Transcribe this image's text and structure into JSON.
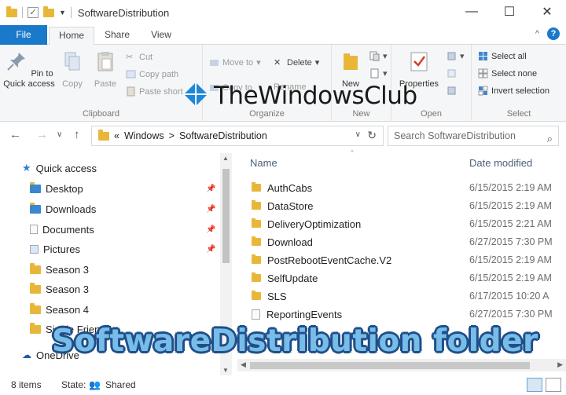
{
  "window": {
    "title": "SoftwareDistribution",
    "buttons": [
      "—",
      "☐",
      "✕"
    ]
  },
  "tabs": {
    "file": "File",
    "home": "Home",
    "share": "Share",
    "view": "View"
  },
  "ribbon": {
    "clipboard": {
      "pin": "Pin to Quick access",
      "copy": "Copy",
      "paste": "Paste",
      "cut": "Cut",
      "copy_path": "Copy path",
      "paste_shortcut": "Paste short",
      "label": "Clipboard"
    },
    "organize": {
      "move_to": "Move to",
      "delete": "Delete",
      "copy_to": "Copy to",
      "rename": "Rename",
      "label": "Organize"
    },
    "new": {
      "new_folder": "New",
      "label": "New"
    },
    "open": {
      "properties": "Properties",
      "label": "Open"
    },
    "select": {
      "select_all": "Select all",
      "select_none": "Select none",
      "invert": "Invert selection",
      "label": "Select"
    }
  },
  "watermark": "TheWindowsClub",
  "address": {
    "prefix": "«",
    "segments": [
      "Windows",
      "SoftwareDistribution"
    ],
    "separator": ">",
    "search_placeholder": "Search SoftwareDistribution"
  },
  "nav": {
    "quick_access": "Quick access",
    "items": [
      {
        "label": "Desktop",
        "pinned": true
      },
      {
        "label": "Downloads",
        "pinned": true
      },
      {
        "label": "Documents",
        "pinned": true
      },
      {
        "label": "Pictures",
        "pinned": true
      },
      {
        "label": "Season 3",
        "pinned": false
      },
      {
        "label": "Season 3",
        "pinned": false
      },
      {
        "label": "Season 4",
        "pinned": false
      },
      {
        "label": "Single Friends",
        "pinned": false
      }
    ],
    "onedrive": "OneDrive"
  },
  "columns": {
    "name": "Name",
    "date_modified": "Date modified"
  },
  "files": [
    {
      "name": "AuthCabs",
      "date": "6/15/2015 2:19 AM",
      "type": "folder"
    },
    {
      "name": "DataStore",
      "date": "6/15/2015 2:19 AM",
      "type": "folder"
    },
    {
      "name": "DeliveryOptimization",
      "date": "6/15/2015 2:21 AM",
      "type": "folder"
    },
    {
      "name": "Download",
      "date": "6/27/2015 7:30 PM",
      "type": "folder"
    },
    {
      "name": "PostRebootEventCache.V2",
      "date": "6/15/2015 2:19 AM",
      "type": "folder"
    },
    {
      "name": "SelfUpdate",
      "date": "6/15/2015 2:19 AM",
      "type": "folder"
    },
    {
      "name": "SLS",
      "date": "6/17/2015 10:20 A",
      "type": "folder"
    },
    {
      "name": "ReportingEvents",
      "date": "6/27/2015 7:30 PM",
      "type": "file"
    }
  ],
  "caption": "SoftwareDistribution folder",
  "status": {
    "count": "8 items",
    "state_label": "State:",
    "state_value": "Shared"
  },
  "colors": {
    "accent": "#1979ca",
    "folder": "#e8b73a",
    "caption_fill": "#78bde8",
    "caption_outline": "#1f4f8a"
  }
}
